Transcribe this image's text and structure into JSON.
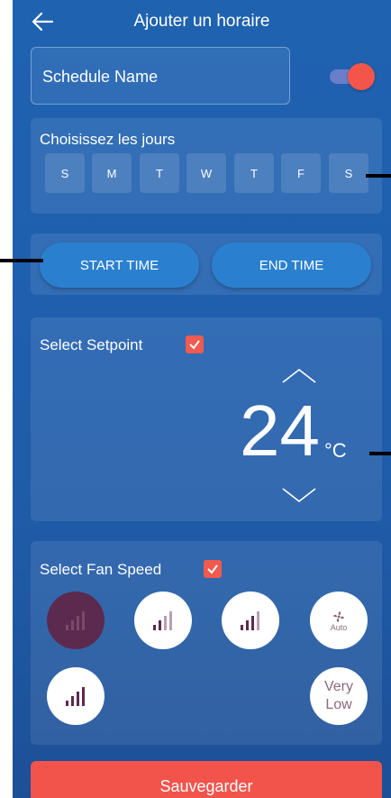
{
  "header": {
    "title": "Ajouter un horaire",
    "back_icon": "arrow-left-icon"
  },
  "schedule": {
    "name_placeholder": "Schedule Name",
    "enabled": true
  },
  "days": {
    "label": "Choisissez les jours",
    "items": [
      "S",
      "M",
      "T",
      "W",
      "T",
      "F",
      "S"
    ]
  },
  "time": {
    "start_label": "START TIME",
    "end_label": "END TIME"
  },
  "setpoint": {
    "label": "Select Setpoint",
    "checked": true,
    "value": "24",
    "unit": "°C"
  },
  "fan": {
    "label": "Select Fan Speed",
    "checked": true,
    "auto_label": "Auto",
    "very_low_label": "Very Low"
  },
  "save_label": "Sauvegarder",
  "colors": {
    "accent": "#f2544c",
    "background": "#1f5fae",
    "active_fan": "#5c2a4e"
  }
}
